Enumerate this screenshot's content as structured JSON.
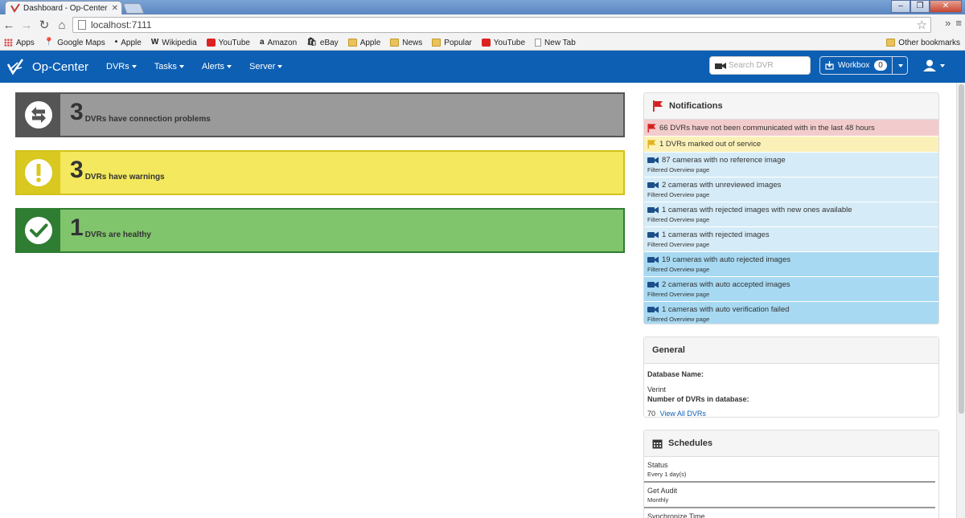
{
  "browser": {
    "tab_title": "Dashboard - Op-Center S",
    "url": "localhost:7111",
    "bookmarks": [
      {
        "label": "Apps",
        "icon": "apps-grid-icon"
      },
      {
        "label": "Google Maps",
        "icon": "maps-icon"
      },
      {
        "label": "Apple",
        "icon": "apple-icon"
      },
      {
        "label": "Wikipedia",
        "icon": "wikipedia-icon"
      },
      {
        "label": "YouTube",
        "icon": "youtube-icon"
      },
      {
        "label": "Amazon",
        "icon": "amazon-icon"
      },
      {
        "label": "eBay",
        "icon": "ebay-icon"
      },
      {
        "label": "Apple",
        "icon": "folder-icon"
      },
      {
        "label": "News",
        "icon": "folder-icon"
      },
      {
        "label": "Popular",
        "icon": "folder-icon"
      },
      {
        "label": "YouTube",
        "icon": "youtube-icon"
      },
      {
        "label": "New Tab",
        "icon": "page-icon"
      }
    ],
    "other_bookmarks": "Other bookmarks"
  },
  "navbar": {
    "brand": "Op-Center",
    "menu": [
      "DVRs",
      "Tasks",
      "Alerts",
      "Server"
    ],
    "search_placeholder": "Search DVR",
    "workbox_label": "Workbox",
    "workbox_count": "0"
  },
  "status": {
    "connection": {
      "count": "3",
      "label": "DVRs have connection problems",
      "color": "#9a9a9a"
    },
    "warnings": {
      "count": "3",
      "label": "DVRs have warnings",
      "color": "#f3e85e"
    },
    "healthy": {
      "count": "1",
      "label": "DVRs are healthy",
      "color": "#80c46c"
    }
  },
  "notifications": {
    "title": "Notifications",
    "items": [
      {
        "text": "66 DVRs have not been communicated with in the last 48 hours",
        "sub": ""
      },
      {
        "text": "1 DVRs marked out of service",
        "sub": ""
      },
      {
        "text": "87 cameras with no reference image",
        "sub": "Filtered Overview page"
      },
      {
        "text": "2 cameras with unreviewed images",
        "sub": "Filtered Overview page"
      },
      {
        "text": "1 cameras with rejected images with new ones available",
        "sub": "Filtered Overview page"
      },
      {
        "text": "1 cameras with rejected images",
        "sub": "Filtered Overview page"
      },
      {
        "text": "19 cameras with auto rejected images",
        "sub": "Filtered Overview page"
      },
      {
        "text": "2 cameras with auto accepted images",
        "sub": "Filtered Overview page"
      },
      {
        "text": "1 cameras with auto verification failed",
        "sub": "Filtered Overview page"
      }
    ]
  },
  "general": {
    "title": "General",
    "db_name_label": "Database Name:",
    "db_name_value": "Verint",
    "dvr_count_label": "Number of DVRs in database:",
    "dvr_count_value": "70",
    "view_all_link": "View All DVRs"
  },
  "schedules": {
    "title": "Schedules",
    "items": [
      {
        "name": "Status",
        "freq": "Every 1 day(s)"
      },
      {
        "name": "Get Audit",
        "freq": "Monthly"
      },
      {
        "name": "Synchronize Time",
        "freq": ""
      }
    ]
  },
  "colors": {
    "brand_blue": "#0d5fb3",
    "notif_red": "#f2cccc",
    "notif_yellow": "#fbf1b8",
    "notif_light_blue": "#d5ebf7",
    "notif_blue": "#a7d9f2"
  }
}
